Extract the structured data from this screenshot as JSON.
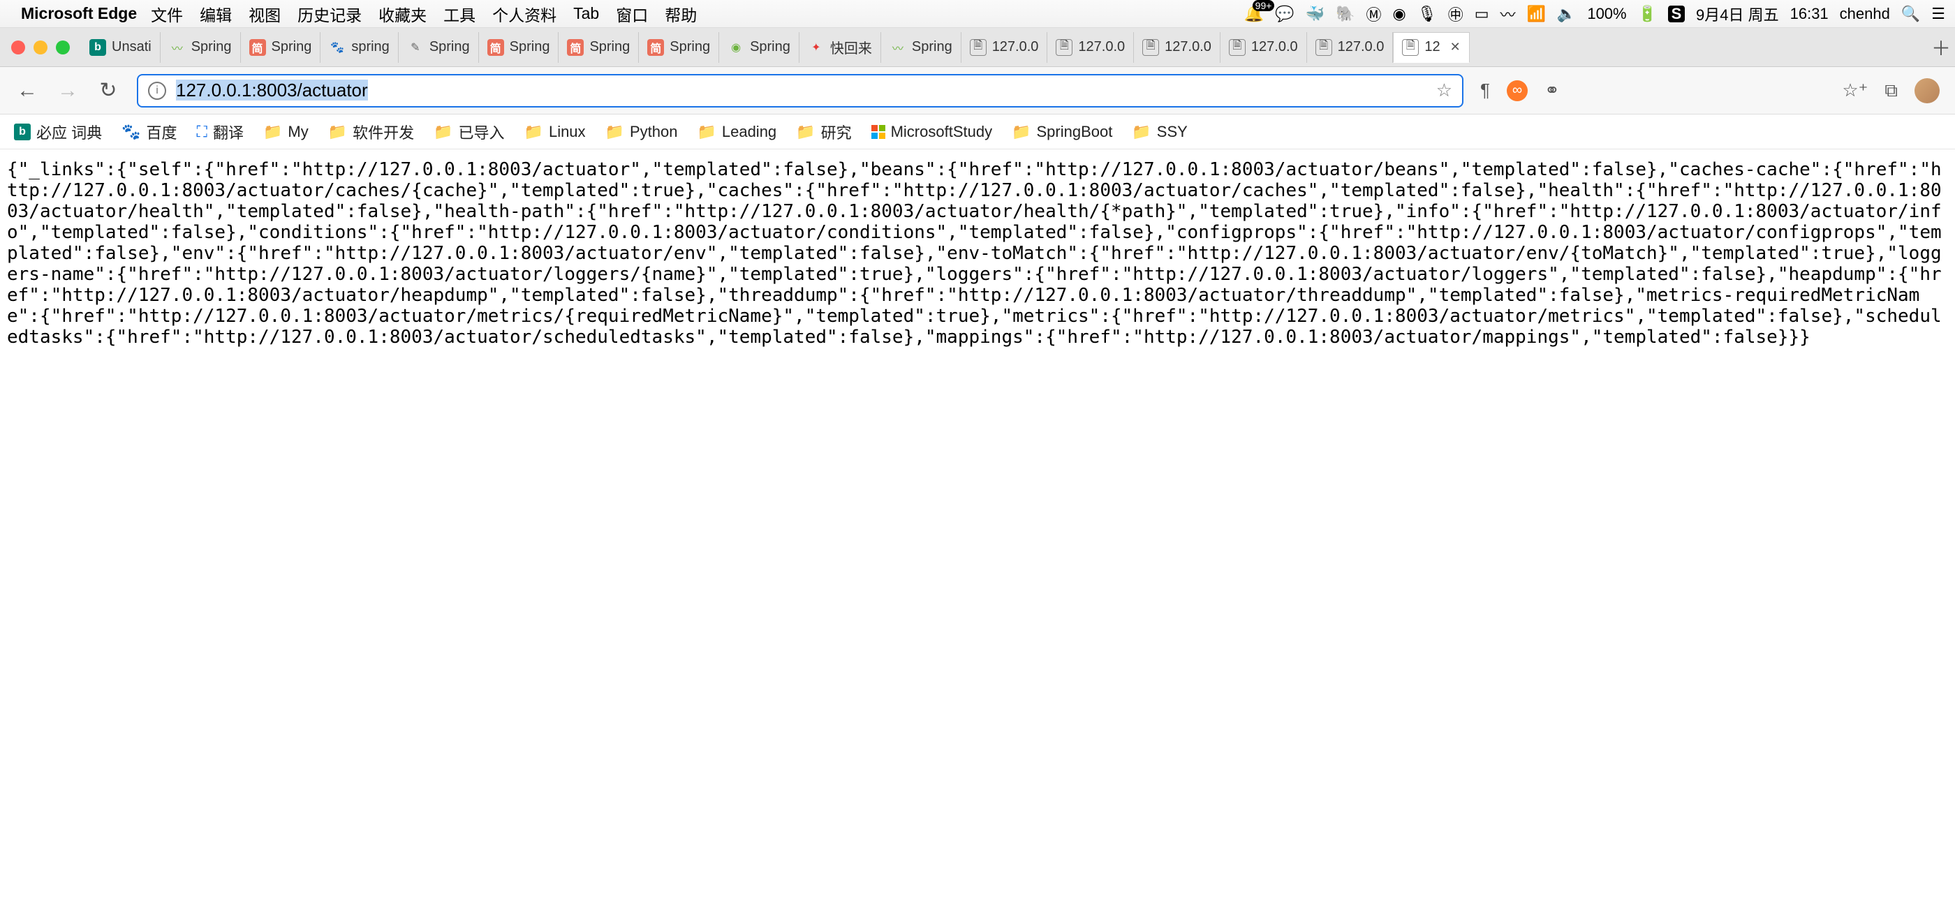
{
  "menubar": {
    "app_name": "Microsoft Edge",
    "items": [
      "文件",
      "编辑",
      "视图",
      "历史记录",
      "收藏夹",
      "工具",
      "个人资料",
      "Tab",
      "窗口",
      "帮助"
    ],
    "notification_count": "99+",
    "battery_pct": "100%",
    "date": "9月4日 周五",
    "time": "16:31",
    "user": "chenhd"
  },
  "tabs": [
    {
      "fav": "bing",
      "title": "Unsati"
    },
    {
      "fav": "spring",
      "title": "Spring"
    },
    {
      "fav": "jian",
      "title": "Spring"
    },
    {
      "fav": "paw",
      "title": "spring"
    },
    {
      "fav": "csdn",
      "title": "Spring"
    },
    {
      "fav": "jian",
      "title": "Spring"
    },
    {
      "fav": "jian",
      "title": "Spring"
    },
    {
      "fav": "jian",
      "title": "Spring"
    },
    {
      "fav": "springio",
      "title": "Spring"
    },
    {
      "fav": "yq",
      "title": "快回来"
    },
    {
      "fav": "spring",
      "title": "Spring"
    },
    {
      "fav": "blank",
      "title": "127.0.0"
    },
    {
      "fav": "blank",
      "title": "127.0.0"
    },
    {
      "fav": "blank",
      "title": "127.0.0"
    },
    {
      "fav": "blank",
      "title": "127.0.0"
    },
    {
      "fav": "blank",
      "title": "127.0.0"
    },
    {
      "fav": "blank",
      "title": "12",
      "active": true
    }
  ],
  "omnibox": {
    "url_plain": "",
    "url_selected": "127.0.0.1:8003/actuator"
  },
  "bookmarks": [
    {
      "icon": "bing",
      "label": "必应 词典"
    },
    {
      "icon": "baidu",
      "label": "百度"
    },
    {
      "icon": "trans",
      "label": "翻译"
    },
    {
      "icon": "folder",
      "label": "My"
    },
    {
      "icon": "folder",
      "label": "软件开发"
    },
    {
      "icon": "folder",
      "label": "已导入"
    },
    {
      "icon": "folder",
      "label": "Linux"
    },
    {
      "icon": "folder",
      "label": "Python"
    },
    {
      "icon": "folder",
      "label": "Leading"
    },
    {
      "icon": "folder",
      "label": "研究"
    },
    {
      "icon": "ms",
      "label": "MicrosoftStudy"
    },
    {
      "icon": "folder",
      "label": "SpringBoot"
    },
    {
      "icon": "folder",
      "label": "SSY"
    }
  ],
  "page_body": "{\"_links\":{\"self\":{\"href\":\"http://127.0.0.1:8003/actuator\",\"templated\":false},\"beans\":{\"href\":\"http://127.0.0.1:8003/actuator/beans\",\"templated\":false},\"caches-cache\":{\"href\":\"http://127.0.0.1:8003/actuator/caches/{cache}\",\"templated\":true},\"caches\":{\"href\":\"http://127.0.0.1:8003/actuator/caches\",\"templated\":false},\"health\":{\"href\":\"http://127.0.0.1:8003/actuator/health\",\"templated\":false},\"health-path\":{\"href\":\"http://127.0.0.1:8003/actuator/health/{*path}\",\"templated\":true},\"info\":{\"href\":\"http://127.0.0.1:8003/actuator/info\",\"templated\":false},\"conditions\":{\"href\":\"http://127.0.0.1:8003/actuator/conditions\",\"templated\":false},\"configprops\":{\"href\":\"http://127.0.0.1:8003/actuator/configprops\",\"templated\":false},\"env\":{\"href\":\"http://127.0.0.1:8003/actuator/env\",\"templated\":false},\"env-toMatch\":{\"href\":\"http://127.0.0.1:8003/actuator/env/{toMatch}\",\"templated\":true},\"loggers-name\":{\"href\":\"http://127.0.0.1:8003/actuator/loggers/{name}\",\"templated\":true},\"loggers\":{\"href\":\"http://127.0.0.1:8003/actuator/loggers\",\"templated\":false},\"heapdump\":{\"href\":\"http://127.0.0.1:8003/actuator/heapdump\",\"templated\":false},\"threaddump\":{\"href\":\"http://127.0.0.1:8003/actuator/threaddump\",\"templated\":false},\"metrics-requiredMetricName\":{\"href\":\"http://127.0.0.1:8003/actuator/metrics/{requiredMetricName}\",\"templated\":true},\"metrics\":{\"href\":\"http://127.0.0.1:8003/actuator/metrics\",\"templated\":false},\"scheduledtasks\":{\"href\":\"http://127.0.0.1:8003/actuator/scheduledtasks\",\"templated\":false},\"mappings\":{\"href\":\"http://127.0.0.1:8003/actuator/mappings\",\"templated\":false}}}"
}
